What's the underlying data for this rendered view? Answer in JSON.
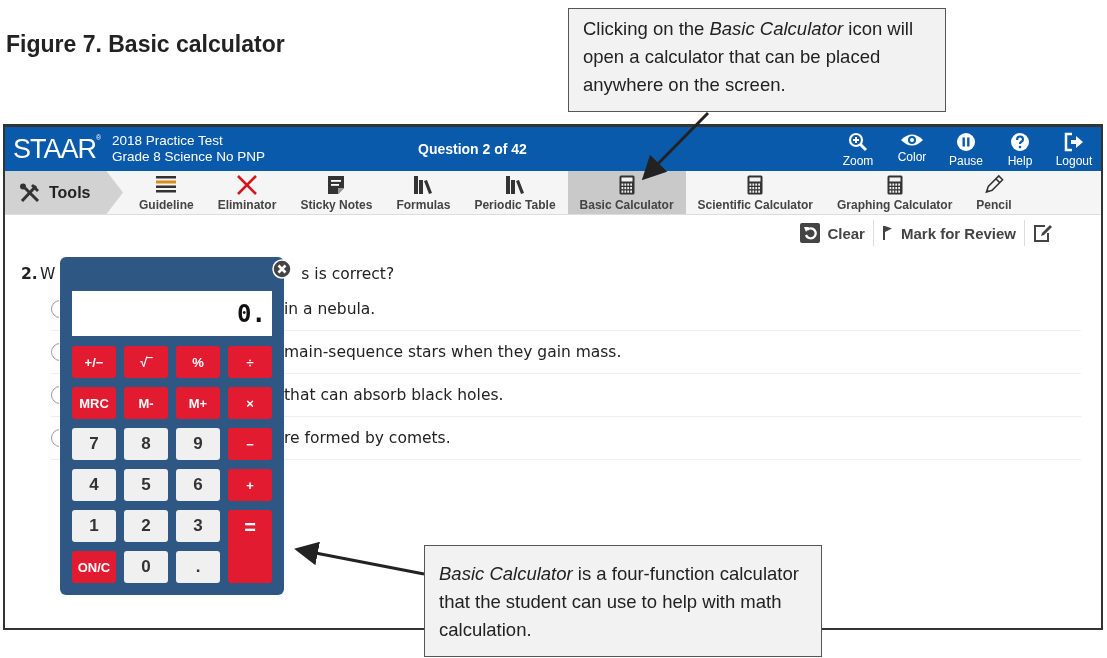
{
  "figure_title": "Figure 7. Basic calculator",
  "callouts": [
    {
      "text": "Clicking on the *Basic Calculator* icon will open a calculator that can be placed anywhere on the screen."
    },
    {
      "text": "*Basic Calculator* is a four-function calculator that the student can use to help with math calculation."
    }
  ],
  "header": {
    "logo": "STAAR$^{®}$",
    "test_name": "2018 Practice Test",
    "test_subtitle": "Grade 8 Science No PNP",
    "question_counter": "Question 2 of 42",
    "actions": [
      {
        "label": "Zoom",
        "kind": "zoom"
      },
      {
        "label": "Color",
        "kind": "color"
      },
      {
        "label": "Pause",
        "kind": "pause"
      },
      {
        "label": "Help",
        "kind": "help"
      },
      {
        "label": "Logout",
        "kind": "logout"
      }
    ]
  },
  "tools_label": "Tools",
  "tools": [
    {
      "label": "Guideline",
      "kind": "guideline",
      "selected": false
    },
    {
      "label": "Eliminator",
      "kind": "eliminator",
      "selected": false
    },
    {
      "label": "Sticky Notes",
      "kind": "notes",
      "selected": false
    },
    {
      "label": "Formulas",
      "kind": "books",
      "selected": false
    },
    {
      "label": "Periodic Table",
      "kind": "books",
      "selected": false
    },
    {
      "label": "Basic Calculator",
      "kind": "calculator",
      "selected": true
    },
    {
      "label": "Scientific Calculator",
      "kind": "calculator",
      "selected": false
    },
    {
      "label": "Graphing Calculator",
      "kind": "calculator",
      "selected": false
    },
    {
      "label": "Pencil",
      "kind": "pencil",
      "selected": false
    }
  ],
  "item_actions": [
    {
      "label": "Clear",
      "kind": "clear"
    },
    {
      "label": "Mark for Review",
      "kind": "flag"
    },
    {
      "kind": "edit"
    }
  ],
  "question": {
    "number": "2.",
    "text_start": "W",
    "text_end": "s is correct?",
    "options": [
      {
        "text": "in a nebula.",
        "selected": false
      },
      {
        "text": "main-sequence stars when they gain mass.",
        "selected": false
      },
      {
        "text": "that can absorb black holes.",
        "selected": false
      },
      {
        "text": "re formed by comets.",
        "selected": false
      }
    ]
  },
  "calculator": {
    "display": "0.",
    "keys": [
      {
        "label": "+/−",
        "kind": "function"
      },
      {
        "label": "√‾",
        "kind": "function"
      },
      {
        "label": "%",
        "kind": "function"
      },
      {
        "label": "÷",
        "kind": "function"
      },
      {
        "label": "MRC",
        "kind": "function"
      },
      {
        "label": "M-",
        "kind": "function"
      },
      {
        "label": "M+",
        "kind": "function"
      },
      {
        "label": "×",
        "kind": "function"
      },
      {
        "label": "7",
        "kind": "digit"
      },
      {
        "label": "8",
        "kind": "digit"
      },
      {
        "label": "9",
        "kind": "digit"
      },
      {
        "label": "−",
        "kind": "function"
      },
      {
        "label": "4",
        "kind": "digit"
      },
      {
        "label": "5",
        "kind": "digit"
      },
      {
        "label": "6",
        "kind": "digit"
      },
      {
        "label": "+",
        "kind": "function"
      },
      {
        "label": "1",
        "kind": "digit"
      },
      {
        "label": "2",
        "kind": "digit"
      },
      {
        "label": "3",
        "kind": "digit"
      },
      {
        "label": "=",
        "kind": "equals"
      },
      {
        "label": "ON/C",
        "kind": "function"
      },
      {
        "label": "0",
        "kind": "digit"
      },
      {
        "label": ".",
        "kind": "digit"
      }
    ]
  }
}
